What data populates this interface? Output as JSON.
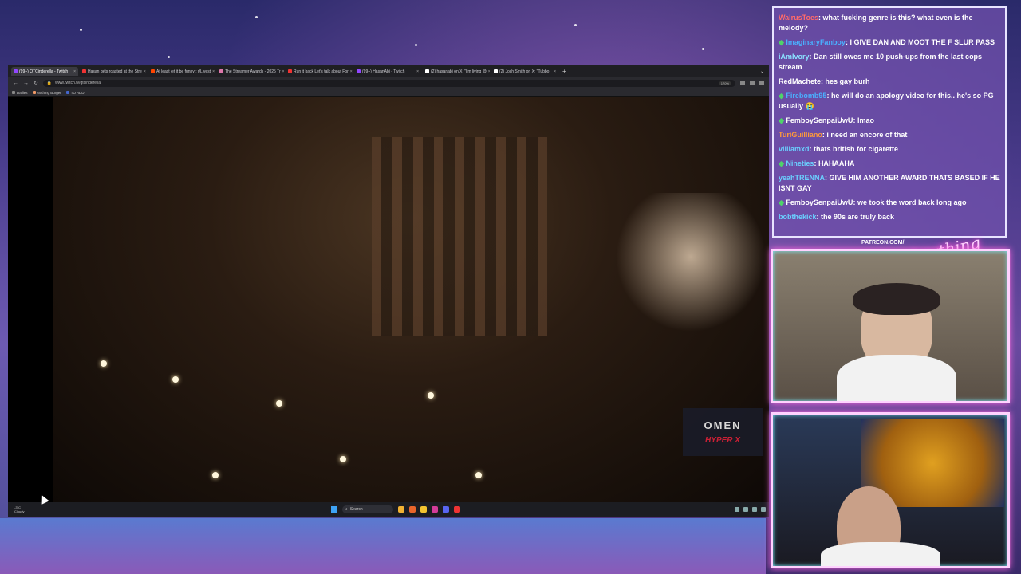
{
  "browser": {
    "tabs": [
      {
        "label": "(99+) QTCinderella - Twitch",
        "color": "#9146ff",
        "active": true
      },
      {
        "label": "Hasan gets roasted at the Stre",
        "color": "#e33",
        "active": false
      },
      {
        "label": "At least let it be funny : r/Livest",
        "color": "#ff4500",
        "active": false
      },
      {
        "label": "The Streamer Awards - 2025 Tr",
        "color": "#d7a",
        "active": false
      },
      {
        "label": "Run it back Let's talk about For",
        "color": "#e33",
        "active": false
      },
      {
        "label": "(99+) HasanAbi - Twitch",
        "color": "#9146ff",
        "active": false
      },
      {
        "label": "(2) hasanabi on X: \"I'm living @",
        "color": "#fff",
        "active": false
      },
      {
        "label": "(2) Josh Smith on X: \"Tubbo",
        "color": "#fff",
        "active": false
      }
    ],
    "new_tab": "+",
    "url": "www.twitch.tv/qtcinderella",
    "zoom": "170%",
    "bookmarks": [
      {
        "label": "Dailies",
        "color": "#888"
      },
      {
        "label": "Nothing Burger",
        "color": "#e96"
      },
      {
        "label": "TO ADD",
        "color": "#46c"
      }
    ]
  },
  "video": {
    "sponsor_primary": "OMEN",
    "sponsor_secondary": "HYPER X"
  },
  "taskbar": {
    "weather_temp": "-3°C",
    "weather_desc": "Cloudy",
    "search_label": "Search"
  },
  "chat": {
    "messages": [
      {
        "user": "WalrusToes",
        "color": "#ff6a6a",
        "text": "what fucking genre is this? what even is the melody?",
        "badge": false
      },
      {
        "user": "ImaginaryFanboy",
        "color": "#4ab0ff",
        "text": "I GIVE DAN AND MOOT THE F SLUR PASS",
        "badge": true
      },
      {
        "user": "iAmIvory",
        "color": "#8ae0ff",
        "text": "Dan still owes me 10 push-ups from the last cops stream",
        "badge": false
      },
      {
        "user": "RedMachete",
        "color": "#ffffff",
        "text": "hes gay burh",
        "badge": false
      },
      {
        "user": "Firebomb95",
        "color": "#4ab0ff",
        "text": "he will do an apology video for this.. he's so PG usually 😭",
        "badge": true
      },
      {
        "user": "FemboySenpaiUwU",
        "color": "#ffffff",
        "text": "lmao",
        "badge": true
      },
      {
        "user": "TuriGuilliano",
        "color": "#ff9a3a",
        "text": "i need an encore of that",
        "badge": false
      },
      {
        "user": "villiamxd",
        "color": "#6ad0ff",
        "text": "thats british for cigarette",
        "badge": false
      },
      {
        "user": "Nineties",
        "color": "#6ad0ff",
        "text": "HAHAAHA",
        "badge": true
      },
      {
        "user": "yeahTRENNA",
        "color": "#6ad0ff",
        "text": "GIVE HIM ANOTHER AWARD THATS BASED IF HE ISNT GAY",
        "badge": false
      },
      {
        "user": "FemboySenpaiUwU",
        "color": "#ffffff",
        "text": "we took the word back long ago",
        "badge": true
      },
      {
        "user": "bobthekick",
        "color": "#6ad0ff",
        "text": "the 90s are truly back",
        "badge": false
      }
    ]
  },
  "overlay": {
    "patreon": "PATREON.COM/",
    "neon_sign": "Anything Else?"
  }
}
